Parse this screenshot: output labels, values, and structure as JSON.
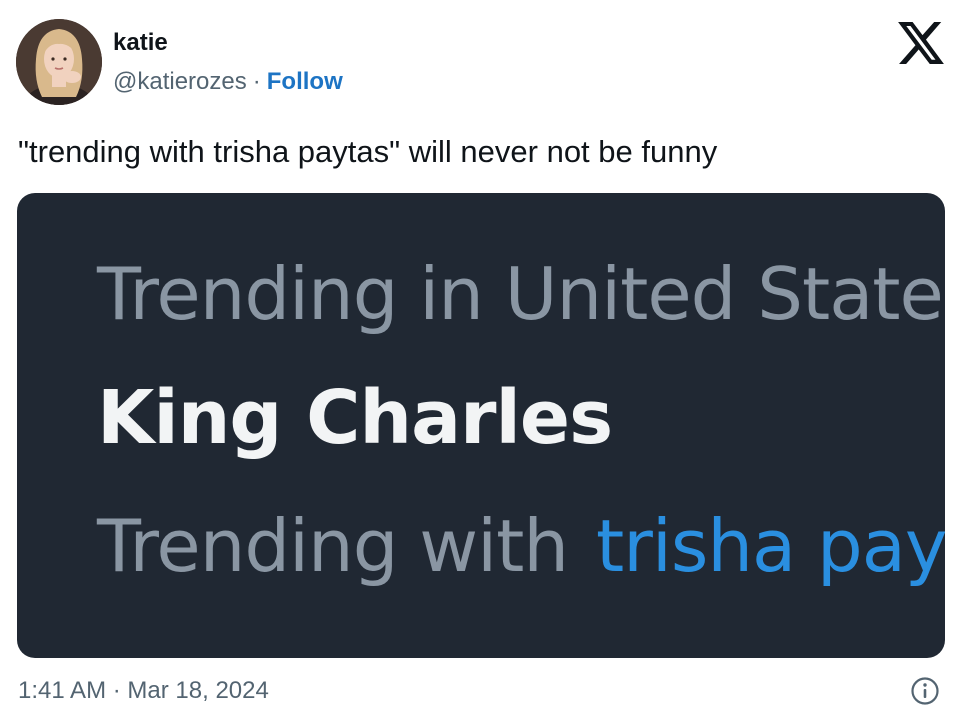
{
  "author": {
    "name": "katie",
    "handle": "@katierozes",
    "separator": "·",
    "follow_label": "Follow"
  },
  "tweet": {
    "text": "\"trending with trisha paytas\" will never not be funny"
  },
  "media": {
    "line1": "Trending in United State",
    "line2": "King Charles",
    "line3_prefix": "Trending with",
    "line3_link": "trisha pay"
  },
  "footer": {
    "time": "1:41 AM",
    "separator": "·",
    "date": "Mar 18, 2024"
  },
  "icons": {
    "brand": "x-logo-icon",
    "info": "info-icon"
  },
  "colors": {
    "follow": "#1d74c4",
    "media_bg": "#202833",
    "link_in_media": "#2a8fe0",
    "secondary_text": "#536471"
  }
}
